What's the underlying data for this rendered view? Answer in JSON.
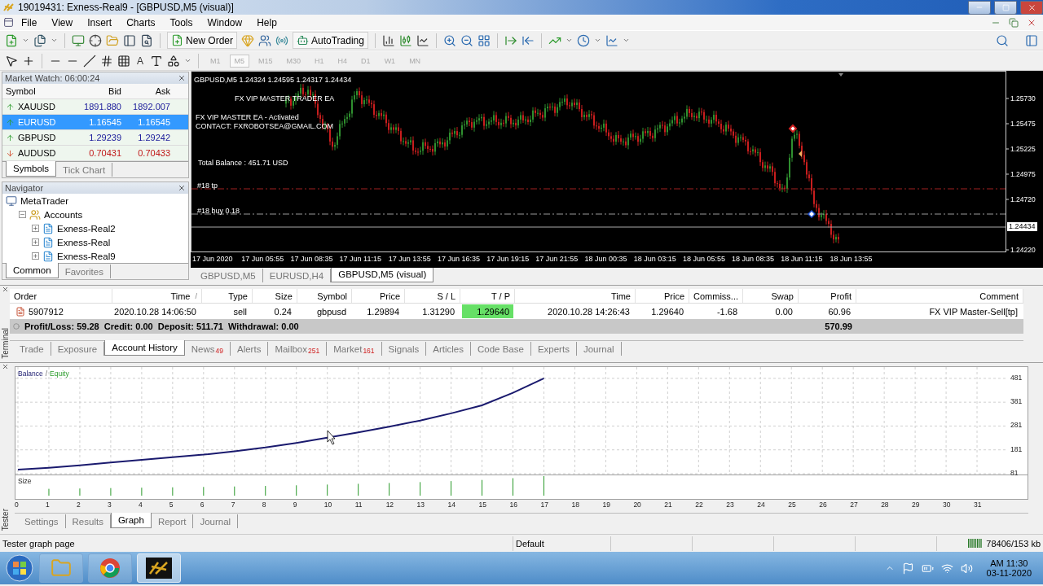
{
  "window": {
    "title": "19019431: Exness-Real9 - [GBPUSD,M5 (visual)]"
  },
  "menu": [
    "File",
    "View",
    "Insert",
    "Charts",
    "Tools",
    "Window",
    "Help"
  ],
  "toolbar": {
    "new_order": "New Order",
    "autotrading": "AutoTrading",
    "text_tool": "A"
  },
  "timeframes": [
    {
      "label": "M1",
      "selected": false
    },
    {
      "label": "M5",
      "selected": true
    },
    {
      "label": "M15",
      "selected": false
    },
    {
      "label": "M30",
      "selected": false
    },
    {
      "label": "H1",
      "selected": false
    },
    {
      "label": "H4",
      "selected": false
    },
    {
      "label": "D1",
      "selected": false
    },
    {
      "label": "W1",
      "selected": false
    },
    {
      "label": "MN",
      "selected": false
    }
  ],
  "market_watch": {
    "title": "Market Watch: 06:00:24",
    "columns": [
      "Symbol",
      "Bid",
      "Ask"
    ],
    "rows": [
      {
        "symbol": "XAUUSD",
        "bid": "1891.880",
        "ask": "1892.007",
        "rising": true,
        "selected": false
      },
      {
        "symbol": "EURUSD",
        "bid": "1.16545",
        "ask": "1.16545",
        "rising": true,
        "selected": true
      },
      {
        "symbol": "GBPUSD",
        "bid": "1.29239",
        "ask": "1.29242",
        "rising": true,
        "selected": false
      },
      {
        "symbol": "AUDUSD",
        "bid": "0.70431",
        "ask": "0.70433",
        "rising": false,
        "selected": false
      }
    ],
    "tabs": [
      {
        "label": "Symbols",
        "selected": true
      },
      {
        "label": "Tick Chart",
        "selected": false
      }
    ]
  },
  "navigator": {
    "title": "Navigator",
    "tree": [
      {
        "label": "MetaTrader",
        "kind": "root",
        "children": [
          {
            "label": "Accounts",
            "kind": "folder",
            "expanded": true,
            "children": [
              {
                "label": "Exness-Real2",
                "kind": "account",
                "expanded": false
              },
              {
                "label": "Exness-Real",
                "kind": "account",
                "expanded": false
              },
              {
                "label": "Exness-Real9",
                "kind": "account",
                "expanded": false
              }
            ]
          }
        ]
      }
    ],
    "tabs": [
      {
        "label": "Common",
        "selected": true
      },
      {
        "label": "Favorites",
        "selected": false
      }
    ]
  },
  "chart": {
    "header": "GBPUSD,M5  1.24324 1.24595 1.24317 1.24434",
    "ea_name": "FX VIP MASTER TRADER EA",
    "ea_status": "FX VIP MASTER EA - Activated",
    "contact": "CONTACT: FXROBOTSEA@GMAIL.COM",
    "balance": "Total Balance  :  451.71 USD",
    "tp_label": "#18 tp",
    "buy_label": "#18 buy 0.18",
    "price_ticks": [
      "1.25730",
      "1.25475",
      "1.25225",
      "1.24975",
      "1.24720",
      "1.24220"
    ],
    "current_price": "1.24434",
    "time_ticks": [
      "17 Jun 2020",
      "17 Jun 05:55",
      "17 Jun 08:35",
      "17 Jun 11:15",
      "17 Jun 13:55",
      "17 Jun 16:35",
      "17 Jun 19:15",
      "17 Jun 21:55",
      "18 Jun 00:35",
      "18 Jun 03:15",
      "18 Jun 05:55",
      "18 Jun 08:35",
      "18 Jun 11:15",
      "18 Jun 13:55"
    ]
  },
  "chart_tabs": [
    {
      "label": "GBPUSD,M5",
      "selected": false
    },
    {
      "label": "EURUSD,H4",
      "selected": false
    },
    {
      "label": "GBPUSD,M5 (visual)",
      "selected": true
    }
  ],
  "terminal": {
    "label": "Terminal",
    "columns": [
      {
        "label": "Order"
      },
      {
        "label": "Time",
        "sort_mark": "/"
      },
      {
        "label": "Type"
      },
      {
        "label": "Size"
      },
      {
        "label": "Symbol"
      },
      {
        "label": "Price"
      },
      {
        "label": "S / L"
      },
      {
        "label": "T / P"
      },
      {
        "label": "Time"
      },
      {
        "label": "Price"
      },
      {
        "label": "Commiss..."
      },
      {
        "label": "Swap"
      },
      {
        "label": "Profit"
      },
      {
        "label": "Comment"
      }
    ],
    "rows": [
      {
        "cells": [
          "5907912",
          "2020.10.28 14:06:50",
          "sell",
          "0.24",
          "gbpusd",
          "1.29894",
          "1.31290",
          "1.29640",
          "2020.10.28 14:26:43",
          "1.29640",
          "-1.68",
          "0.00",
          "60.96",
          "FX VIP Master-Sell[tp]"
        ],
        "tp_hit": true
      }
    ],
    "summary": "Profit/Loss: 59.28  Credit: 0.00  Deposit: 511.71  Withdrawal: 0.00",
    "total": "570.99",
    "tabs": [
      {
        "label": "Trade",
        "selected": false
      },
      {
        "label": "Exposure",
        "selected": false
      },
      {
        "label": "Account History",
        "selected": true
      },
      {
        "label": "News",
        "count": "49",
        "selected": false
      },
      {
        "label": "Alerts",
        "selected": false
      },
      {
        "label": "Mailbox",
        "count": "251",
        "selected": false
      },
      {
        "label": "Market",
        "count": "161",
        "selected": false
      },
      {
        "label": "Signals",
        "selected": false
      },
      {
        "label": "Articles",
        "selected": false
      },
      {
        "label": "Code Base",
        "selected": false
      },
      {
        "label": "Experts",
        "selected": false
      },
      {
        "label": "Journal",
        "selected": false
      }
    ]
  },
  "tester": {
    "label": "Tester",
    "legend": {
      "separator": "/",
      "equity": "Equity"
    },
    "size_label": "Size",
    "chart_data": {
      "type": "line",
      "x": [
        0,
        1,
        2,
        3,
        4,
        5,
        6,
        7,
        8,
        9,
        10,
        11,
        12,
        13,
        14,
        15,
        16,
        17
      ],
      "series": [
        {
          "name": "Balance",
          "color": "#1a1a6e",
          "values": [
            98,
            106,
            116,
            128,
            139,
            150,
            161,
            175,
            191,
            210,
            232,
            254,
            278,
            304,
            334,
            368,
            420,
            481
          ]
        }
      ],
      "xlim": [
        0,
        32
      ],
      "ylim": [
        81,
        525
      ],
      "xticks": [
        0,
        1,
        2,
        3,
        4,
        5,
        6,
        7,
        8,
        9,
        10,
        11,
        12,
        13,
        14,
        15,
        16,
        17,
        18,
        19,
        20,
        21,
        22,
        23,
        24,
        25,
        26,
        27,
        28,
        29,
        30,
        31
      ],
      "yticks": [
        81,
        181,
        281,
        381,
        481
      ],
      "grid": true
    },
    "tabs": [
      {
        "label": "Settings",
        "selected": false
      },
      {
        "label": "Results",
        "selected": false
      },
      {
        "label": "Graph",
        "selected": true
      },
      {
        "label": "Report",
        "selected": false
      },
      {
        "label": "Journal",
        "selected": false
      }
    ]
  },
  "status_bar": {
    "message": "Tester graph page",
    "profile": "Default",
    "traffic": "78406/153 kb"
  },
  "taskbar": {
    "time": "AM 11:30",
    "date": "03-11-2020"
  }
}
